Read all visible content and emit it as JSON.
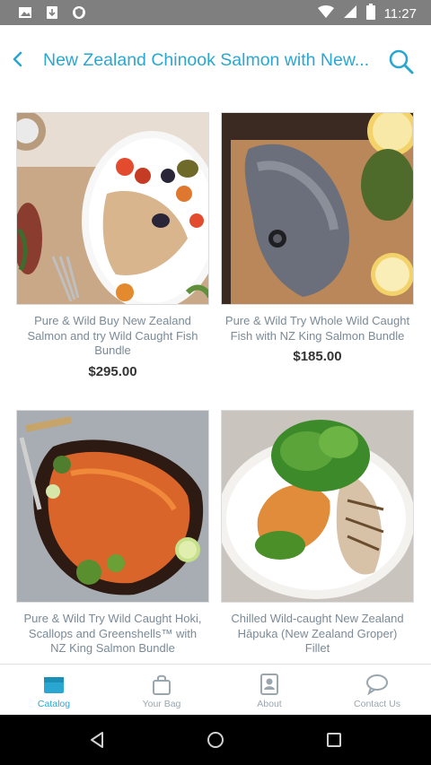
{
  "status_bar": {
    "time": "11:27",
    "left_icons": [
      "image-icon",
      "download-icon",
      "shield-icon"
    ],
    "right_icons": [
      "wifi-icon",
      "signal-icon",
      "battery-icon"
    ]
  },
  "header": {
    "title": "New Zealand Chinook Salmon with New...",
    "back_icon": "chevron-left-icon",
    "search_icon": "search-icon",
    "accent_color": "#2aa7d1"
  },
  "products": [
    {
      "name": "Pure & Wild Buy New Zealand Salmon and try Wild Caught Fish Bundle",
      "price": "$295.00"
    },
    {
      "name": "Pure & Wild Try Whole Wild Caught Fish with NZ King Salmon Bundle",
      "price": "$185.00"
    },
    {
      "name": "Pure & Wild Try Wild Caught Hoki, Scallops and Greenshells™ with NZ King Salmon Bundle",
      "price": ""
    },
    {
      "name": "Chilled Wild-caught New Zealand Hāpuka (New Zealand Groper) Fillet",
      "price": ""
    }
  ],
  "tabs": [
    {
      "label": "Catalog",
      "icon": "catalog-icon",
      "active": true
    },
    {
      "label": "Your Bag",
      "icon": "bag-icon",
      "active": false
    },
    {
      "label": "About",
      "icon": "about-icon",
      "active": false
    },
    {
      "label": "Contact Us",
      "icon": "chat-icon",
      "active": false
    }
  ],
  "nav": [
    "back-nav-icon",
    "home-nav-icon",
    "recents-nav-icon"
  ]
}
